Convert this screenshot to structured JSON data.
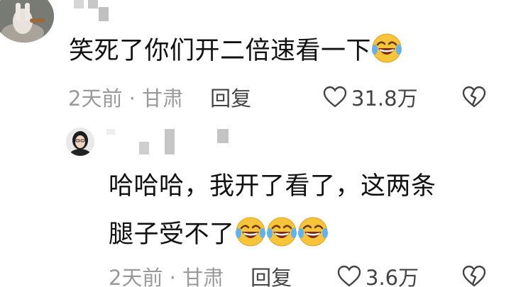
{
  "comments": [
    {
      "text": "笑死了你们开二倍速看一下",
      "emoji_icon": "laughing-crying-emoji-icon",
      "time_location": "2天前 · 甘肃",
      "reply_label": "回复",
      "likes": "31.8万"
    },
    {
      "line1": "哈哈哈，我开了看了，这两条",
      "line2": "腿子受不了",
      "emoji_icon": "laughing-crying-emoji-icon",
      "time_location": "2天前 · 甘肃",
      "reply_label": "回复",
      "likes": "3.6万"
    }
  ],
  "icons": {
    "like": "heart-outline-icon",
    "dislike": "broken-heart-icon"
  },
  "colors": {
    "text": "#111111",
    "meta": "#9a9a9a",
    "action": "#444444",
    "emoji_face": "#f7c43a"
  }
}
